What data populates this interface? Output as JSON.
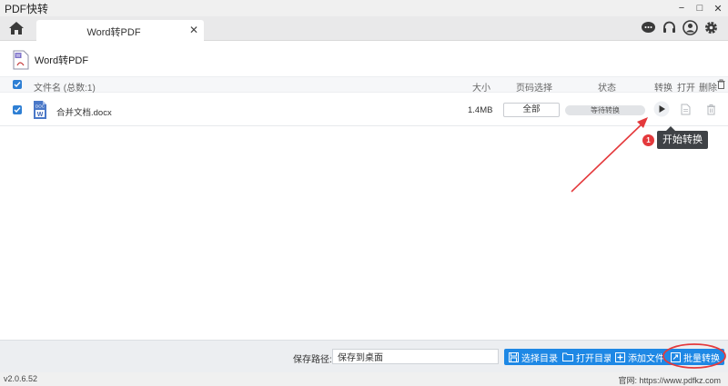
{
  "window": {
    "title": "PDF快转",
    "controls": [
      "minimize-icon",
      "maximize-icon",
      "close-icon"
    ]
  },
  "tabs": [
    {
      "label": "Word转PDF",
      "close": "✕"
    }
  ],
  "header_icons": [
    "chat-icon",
    "headset-icon",
    "user-icon",
    "gear-icon"
  ],
  "section": {
    "title": "Word转PDF"
  },
  "list": {
    "columns": {
      "name": "文件名 (总数:1)",
      "size": "大小",
      "pages": "页码选择",
      "status": "状态",
      "convert": "转换",
      "open": "打开",
      "delete": "删除"
    },
    "rows": [
      {
        "file_type": "DOC",
        "file_badge": "W",
        "name": "合并文档.docx",
        "size": "1.4MB",
        "pages": "全部",
        "status": "等待转换"
      }
    ]
  },
  "tooltip": {
    "badge": "1",
    "text": "开始转换"
  },
  "bottom": {
    "save_label": "保存路径:",
    "save_path": "保存到桌面",
    "buttons": {
      "choose_dir": "选择目录",
      "open_dir": "打开目录",
      "add_file": "添加文件",
      "batch_convert": "批量转换"
    }
  },
  "statusbar": {
    "version": "v2.0.6.52",
    "site": "官网: https://www.pdfkz.com"
  },
  "colors": {
    "accent": "#1e88e5",
    "checkbox": "#2e7fd4",
    "annotation": "#e4393c",
    "tooltip_bg": "#3f4246"
  }
}
